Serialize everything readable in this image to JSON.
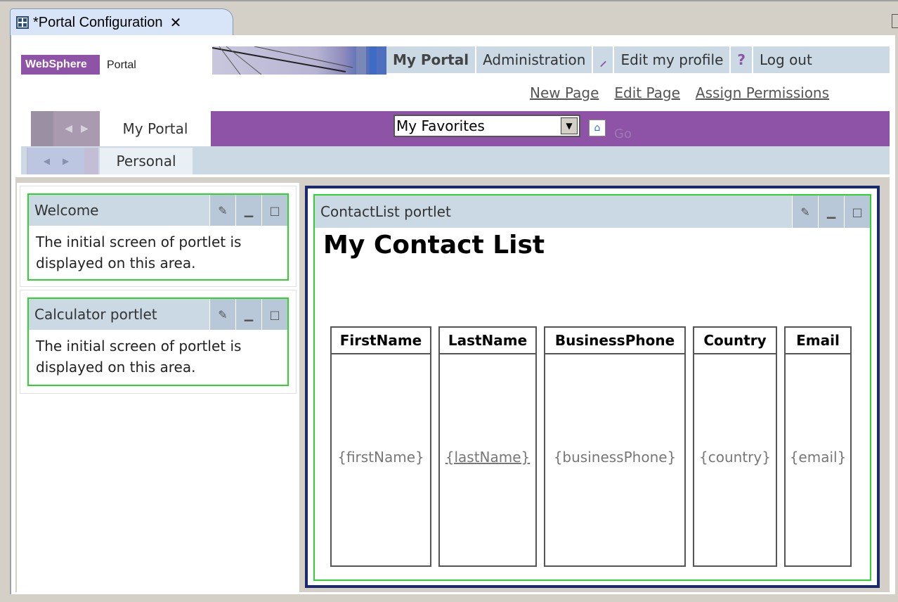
{
  "editor_tab": {
    "title": "*Portal Configuration",
    "close": "✕"
  },
  "header": {
    "logo_brand": "WebSphere",
    "logo_product": "Portal",
    "nav": [
      "My Portal",
      "Administration",
      "Edit my profile",
      "Log out"
    ],
    "help_glyph": "?",
    "page_links": [
      "New Page",
      "Edit Page",
      "Assign Permissions"
    ]
  },
  "nav1": {
    "tab": "My Portal",
    "select_value": "My Favorites",
    "go": "Go"
  },
  "nav2": {
    "tab": "Personal"
  },
  "portlets": [
    {
      "title": "Welcome",
      "body": "The initial screen of portlet is displayed on this area."
    },
    {
      "title": "Calculator portlet",
      "body": "The initial screen of portlet is displayed on this area."
    }
  ],
  "contact": {
    "portlet_title": "ContactList portlet",
    "heading": "My Contact List",
    "columns": [
      {
        "header": "FirstName",
        "value": "{firstName}"
      },
      {
        "header": "LastName",
        "value": "{lastName}"
      },
      {
        "header": "BusinessPhone",
        "value": "{businessPhone}"
      },
      {
        "header": "Country",
        "value": "{country}"
      },
      {
        "header": "Email",
        "value": "{email}"
      }
    ]
  },
  "colors": {
    "accent_purple": "#8e53a6",
    "nav_blue": "#cad9e4",
    "portlet_border": "#2fd22f",
    "selected_border": "#1a2a6e"
  },
  "icons": [
    "portal-config-icon",
    "close-icon",
    "wrench-icon",
    "help-icon",
    "dropdown-arrow-icon",
    "go-icon",
    "edit-icon",
    "minimize-icon",
    "maximize-icon"
  ]
}
